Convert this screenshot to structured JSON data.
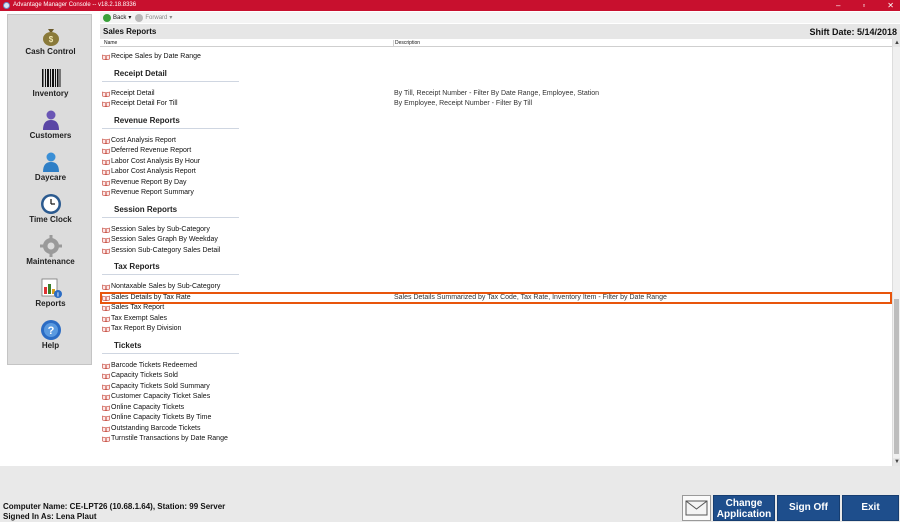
{
  "window": {
    "title": "Advantage Manager Console -- v18.2.18.8336",
    "minimize": "–",
    "maximize": "▫",
    "close": "✕"
  },
  "toolbar": {
    "back": "Back",
    "forward": "Forward"
  },
  "header": {
    "title": "Sales Reports",
    "shift_date": "Shift Date: 5/14/2018"
  },
  "columns": {
    "name": "Name",
    "description": "Description"
  },
  "nav": {
    "cash_control": "Cash Control",
    "inventory": "Inventory",
    "customers": "Customers",
    "daycare": "Daycare",
    "time_clock": "Time Clock",
    "maintenance": "Maintenance",
    "reports": "Reports",
    "help": "Help"
  },
  "top_items": [
    {
      "name": "Recipe Sales by Date Range",
      "desc": ""
    }
  ],
  "groups": [
    {
      "title": "Receipt Detail",
      "items": [
        {
          "name": "Receipt Detail",
          "desc": "By Till, Receipt Number - Filter By Date Range, Employee, Station"
        },
        {
          "name": "Receipt Detail For Till",
          "desc": "By Employee, Receipt Number - Filter By Till"
        }
      ]
    },
    {
      "title": "Revenue Reports",
      "items": [
        {
          "name": "Cost Analysis Report",
          "desc": ""
        },
        {
          "name": "Deferred Revenue Report",
          "desc": ""
        },
        {
          "name": "Labor Cost Analysis By Hour",
          "desc": ""
        },
        {
          "name": "Labor Cost Analysis Report",
          "desc": ""
        },
        {
          "name": "Revenue Report By Day",
          "desc": ""
        },
        {
          "name": "Revenue Report Summary",
          "desc": ""
        }
      ]
    },
    {
      "title": "Session Reports",
      "items": [
        {
          "name": "Session Sales by Sub-Category",
          "desc": ""
        },
        {
          "name": "Session Sales Graph By Weekday",
          "desc": ""
        },
        {
          "name": "Session Sub-Category Sales Detail",
          "desc": ""
        }
      ]
    },
    {
      "title": "Tax Reports",
      "items": [
        {
          "name": "Nontaxable Sales by Sub-Category",
          "desc": ""
        },
        {
          "name": "Sales Details by Tax Rate",
          "desc": "Sales Details Summarized by Tax Code, Tax Rate, Inventory Item - Filter by Date Range",
          "highlighted": true
        },
        {
          "name": "Sales Tax Report",
          "desc": ""
        },
        {
          "name": "Tax Exempt Sales",
          "desc": ""
        },
        {
          "name": "Tax Report By Division",
          "desc": ""
        }
      ]
    },
    {
      "title": "Tickets",
      "items": [
        {
          "name": "Barcode Tickets Redeemed",
          "desc": ""
        },
        {
          "name": "Capacity Tickets Sold",
          "desc": ""
        },
        {
          "name": "Capacity Tickets Sold Summary",
          "desc": ""
        },
        {
          "name": "Customer Capacity Ticket Sales",
          "desc": ""
        },
        {
          "name": "Online Capacity Tickets",
          "desc": ""
        },
        {
          "name": "Online Capacity Tickets By Time",
          "desc": ""
        },
        {
          "name": "Outstanding Barcode Tickets",
          "desc": ""
        },
        {
          "name": "Turnstile Transactions by Date Range",
          "desc": ""
        }
      ]
    }
  ],
  "status": {
    "computer": "Computer Name: CE-LPT26 (10.68.1.64), Station: 99 Server",
    "signed_in": "Signed In As: Lena Plaut"
  },
  "buttons": {
    "change_application_1": "Change",
    "change_application_2": "Application",
    "sign_off": "Sign Off",
    "exit": "Exit"
  },
  "colors": {
    "titlebar": "#c8102e",
    "button": "#1e4e8c",
    "highlight": "#e8550c"
  }
}
